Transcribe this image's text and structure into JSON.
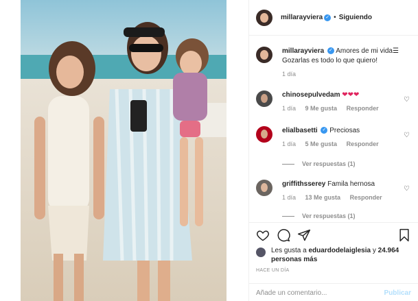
{
  "post_author": {
    "username": "millarayviera",
    "follow_status": "Siguiendo"
  },
  "comments": [
    {
      "username": "millarayviera",
      "text": "Amores de mi vida☰ Gozarlas es todo lo que quiero!",
      "time": "1 día",
      "verified": true
    },
    {
      "username": "chinosepulvedam",
      "text": "❤❤❤",
      "time": "1 día",
      "likes": "9 Me gusta",
      "reply": "Responder"
    },
    {
      "username": "elialbasetti",
      "text": "Preciosas",
      "time": "1 día",
      "likes": "5 Me gusta",
      "reply": "Responder",
      "verified": true,
      "view_replies": "Ver respuestas (1)"
    },
    {
      "username": "griffithsserey",
      "text": "Famila hernosa",
      "time": "1 día",
      "likes": "13 Me gusta",
      "reply": "Responder",
      "view_replies": "Ver respuestas (1)"
    }
  ],
  "likes_summary": {
    "prefix": "Les gusta a",
    "user": "eduardodelaiglesia",
    "joiner": "y",
    "others": "24.964 personas más"
  },
  "time_ago": "HACE UN DÍA",
  "add_comment": {
    "placeholder": "Añade un comentario...",
    "publish_label": "Publicar"
  },
  "icons": {
    "like": "heart-icon",
    "comment": "comment-icon",
    "share": "paper-plane-icon",
    "save": "bookmark-icon"
  }
}
